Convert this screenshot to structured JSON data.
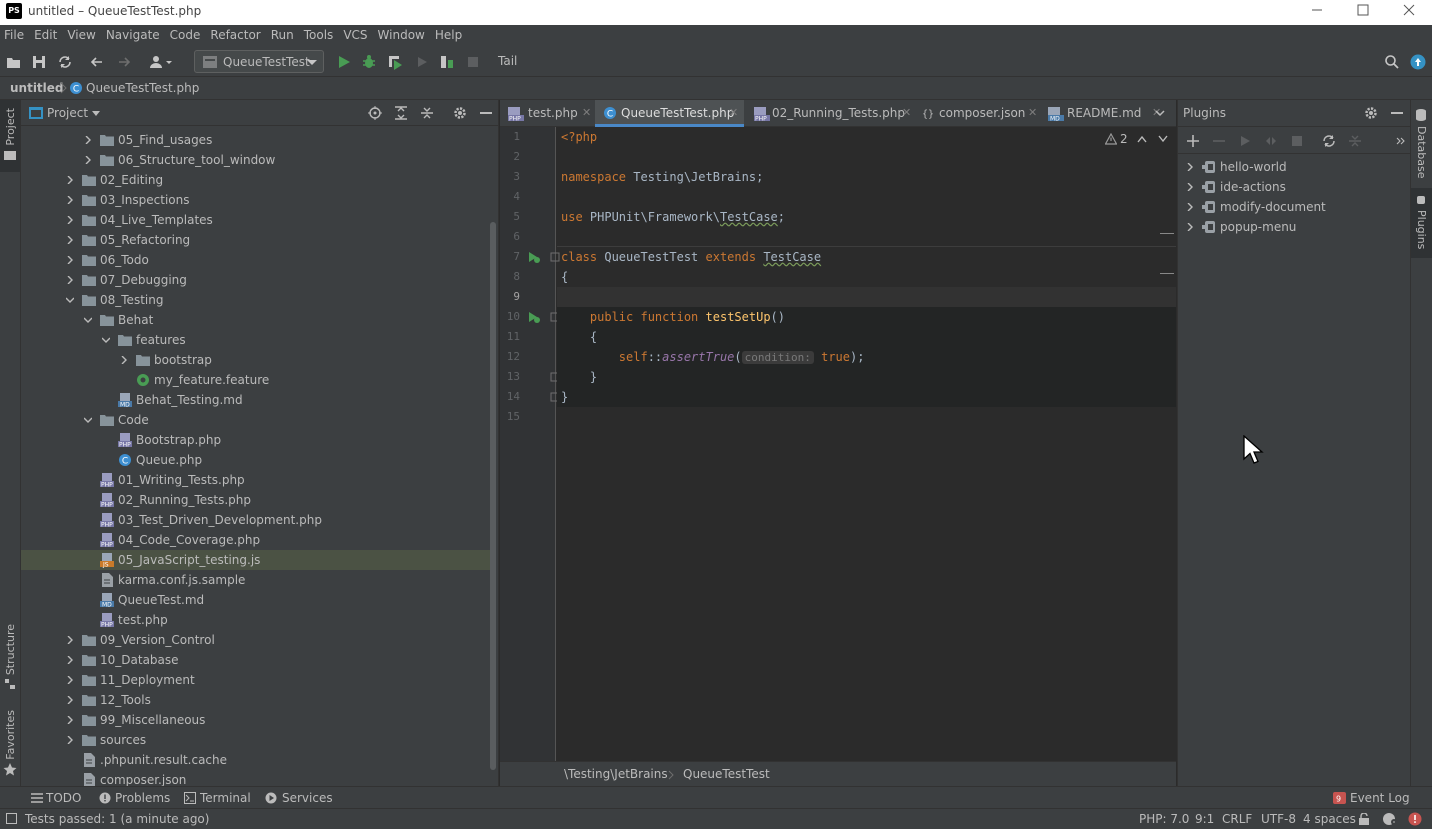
{
  "window": {
    "title": "untitled – QueueTestTest.php",
    "app_logo": "PS"
  },
  "menu": [
    "File",
    "Edit",
    "View",
    "Navigate",
    "Code",
    "Refactor",
    "Run",
    "Tools",
    "VCS",
    "Window",
    "Help"
  ],
  "toolbar": {
    "run_config": "QueueTestTest",
    "tail_label": "Tail"
  },
  "navbar": {
    "project": "untitled",
    "file": "QueueTestTest.php"
  },
  "left_strip": {
    "project": "Project",
    "structure": "Structure",
    "favorites": "Favorites"
  },
  "project_panel": {
    "title": "Project",
    "tree": [
      {
        "label": "05_Find_usages",
        "type": "folder",
        "depth": 3,
        "expanded": false
      },
      {
        "label": "06_Structure_tool_window",
        "type": "folder",
        "depth": 3,
        "expanded": false
      },
      {
        "label": "02_Editing",
        "type": "folder",
        "depth": 2,
        "expanded": false
      },
      {
        "label": "03_Inspections",
        "type": "folder",
        "depth": 2,
        "expanded": false
      },
      {
        "label": "04_Live_Templates",
        "type": "folder",
        "depth": 2,
        "expanded": false
      },
      {
        "label": "05_Refactoring",
        "type": "folder",
        "depth": 2,
        "expanded": false
      },
      {
        "label": "06_Todo",
        "type": "folder",
        "depth": 2,
        "expanded": false
      },
      {
        "label": "07_Debugging",
        "type": "folder",
        "depth": 2,
        "expanded": false
      },
      {
        "label": "08_Testing",
        "type": "folder",
        "depth": 2,
        "expanded": true
      },
      {
        "label": "Behat",
        "type": "folder",
        "depth": 3,
        "expanded": true
      },
      {
        "label": "features",
        "type": "folder",
        "depth": 4,
        "expanded": true
      },
      {
        "label": "bootstrap",
        "type": "folder",
        "depth": 5,
        "expanded": false
      },
      {
        "label": "my_feature.feature",
        "type": "feature",
        "depth": 5
      },
      {
        "label": "Behat_Testing.md",
        "type": "md",
        "depth": 4
      },
      {
        "label": "Code",
        "type": "folder",
        "depth": 3,
        "expanded": true
      },
      {
        "label": "Bootstrap.php",
        "type": "php",
        "depth": 4
      },
      {
        "label": "Queue.php",
        "type": "class",
        "depth": 4
      },
      {
        "label": "01_Writing_Tests.php",
        "type": "php",
        "depth": 3
      },
      {
        "label": "02_Running_Tests.php",
        "type": "php",
        "depth": 3
      },
      {
        "label": "03_Test_Driven_Development.php",
        "type": "php",
        "depth": 3
      },
      {
        "label": "04_Code_Coverage.php",
        "type": "php",
        "depth": 3
      },
      {
        "label": "05_JavaScript_testing.js",
        "type": "js",
        "depth": 3,
        "selected": true
      },
      {
        "label": "karma.conf.js.sample",
        "type": "text",
        "depth": 3
      },
      {
        "label": "QueueTest.md",
        "type": "md",
        "depth": 3
      },
      {
        "label": "test.php",
        "type": "php",
        "depth": 3
      },
      {
        "label": "09_Version_Control",
        "type": "folder",
        "depth": 2,
        "expanded": false
      },
      {
        "label": "10_Database",
        "type": "folder",
        "depth": 2,
        "expanded": false
      },
      {
        "label": "11_Deployment",
        "type": "folder",
        "depth": 2,
        "expanded": false
      },
      {
        "label": "12_Tools",
        "type": "folder",
        "depth": 2,
        "expanded": false
      },
      {
        "label": "99_Miscellaneous",
        "type": "folder",
        "depth": 2,
        "expanded": false
      },
      {
        "label": "sources",
        "type": "folder",
        "depth": 2,
        "expanded": false
      },
      {
        "label": ".phpunit.result.cache",
        "type": "text",
        "depth": 2
      },
      {
        "label": "composer.json",
        "type": "text",
        "depth": 2
      }
    ]
  },
  "editor": {
    "tabs": [
      {
        "label": "test.php",
        "active": false
      },
      {
        "label": "QueueTestTest.php",
        "active": true
      },
      {
        "label": "02_Running_Tests.php",
        "active": false
      },
      {
        "label": "composer.json",
        "active": false
      },
      {
        "label": "README.md",
        "active": false
      }
    ],
    "warnings_count": "2",
    "line_numbers": [
      "1",
      "2",
      "3",
      "4",
      "5",
      "6",
      "7",
      "8",
      "9",
      "10",
      "11",
      "12",
      "13",
      "14",
      "15"
    ],
    "code": {
      "l1": "<?php",
      "l3_kw": "namespace",
      "l3_rest": " Testing\\JetBrains;",
      "l5_kw": "use",
      "l5_rest": " PHPUnit\\Framework\\",
      "l5_cls": "TestCase",
      "l5_end": ";",
      "l7_kw1": "class",
      "l7_name": " QueueTestTest ",
      "l7_kw2": "extends",
      "l7_sp": " ",
      "l7_parent": "TestCase",
      "l8": "{",
      "l10_indent": "    ",
      "l10_kw": "public function",
      "l10_sp": " ",
      "l10_fn": "testSetUp",
      "l10_end": "()",
      "l11": "    {",
      "l12_indent": "        ",
      "l12_self": "self",
      "l12_sep": "::",
      "l12_call": "assertTrue",
      "l12_open": "(",
      "l12_hint": "condition:",
      "l12_sp": " ",
      "l12_val": "true",
      "l12_end": ");",
      "l13": "    }",
      "l14": "}"
    },
    "breadcrumbs": [
      "\\Testing\\JetBrains",
      "QueueTestTest"
    ]
  },
  "plugins_panel": {
    "title": "Plugins",
    "items": [
      "hello-world",
      "ide-actions",
      "modify-document",
      "popup-menu"
    ]
  },
  "right_strip": {
    "database": "Database",
    "plugins": "Plugins"
  },
  "bottom_tools": {
    "todo": "TODO",
    "problems": "Problems",
    "terminal": "Terminal",
    "services": "Services",
    "event_log": "Event Log"
  },
  "status": {
    "message": "Tests passed: 1 (a minute ago)",
    "php": "PHP: 7.0",
    "position": "9:1",
    "line_sep": "CRLF",
    "encoding": "UTF-8",
    "indent": "4 spaces"
  },
  "colors": {
    "accent": "#4a88c7",
    "selection": "#4b5244",
    "keyword": "#cc7832",
    "function": "#ffc66d",
    "run_green": "#499c54"
  }
}
